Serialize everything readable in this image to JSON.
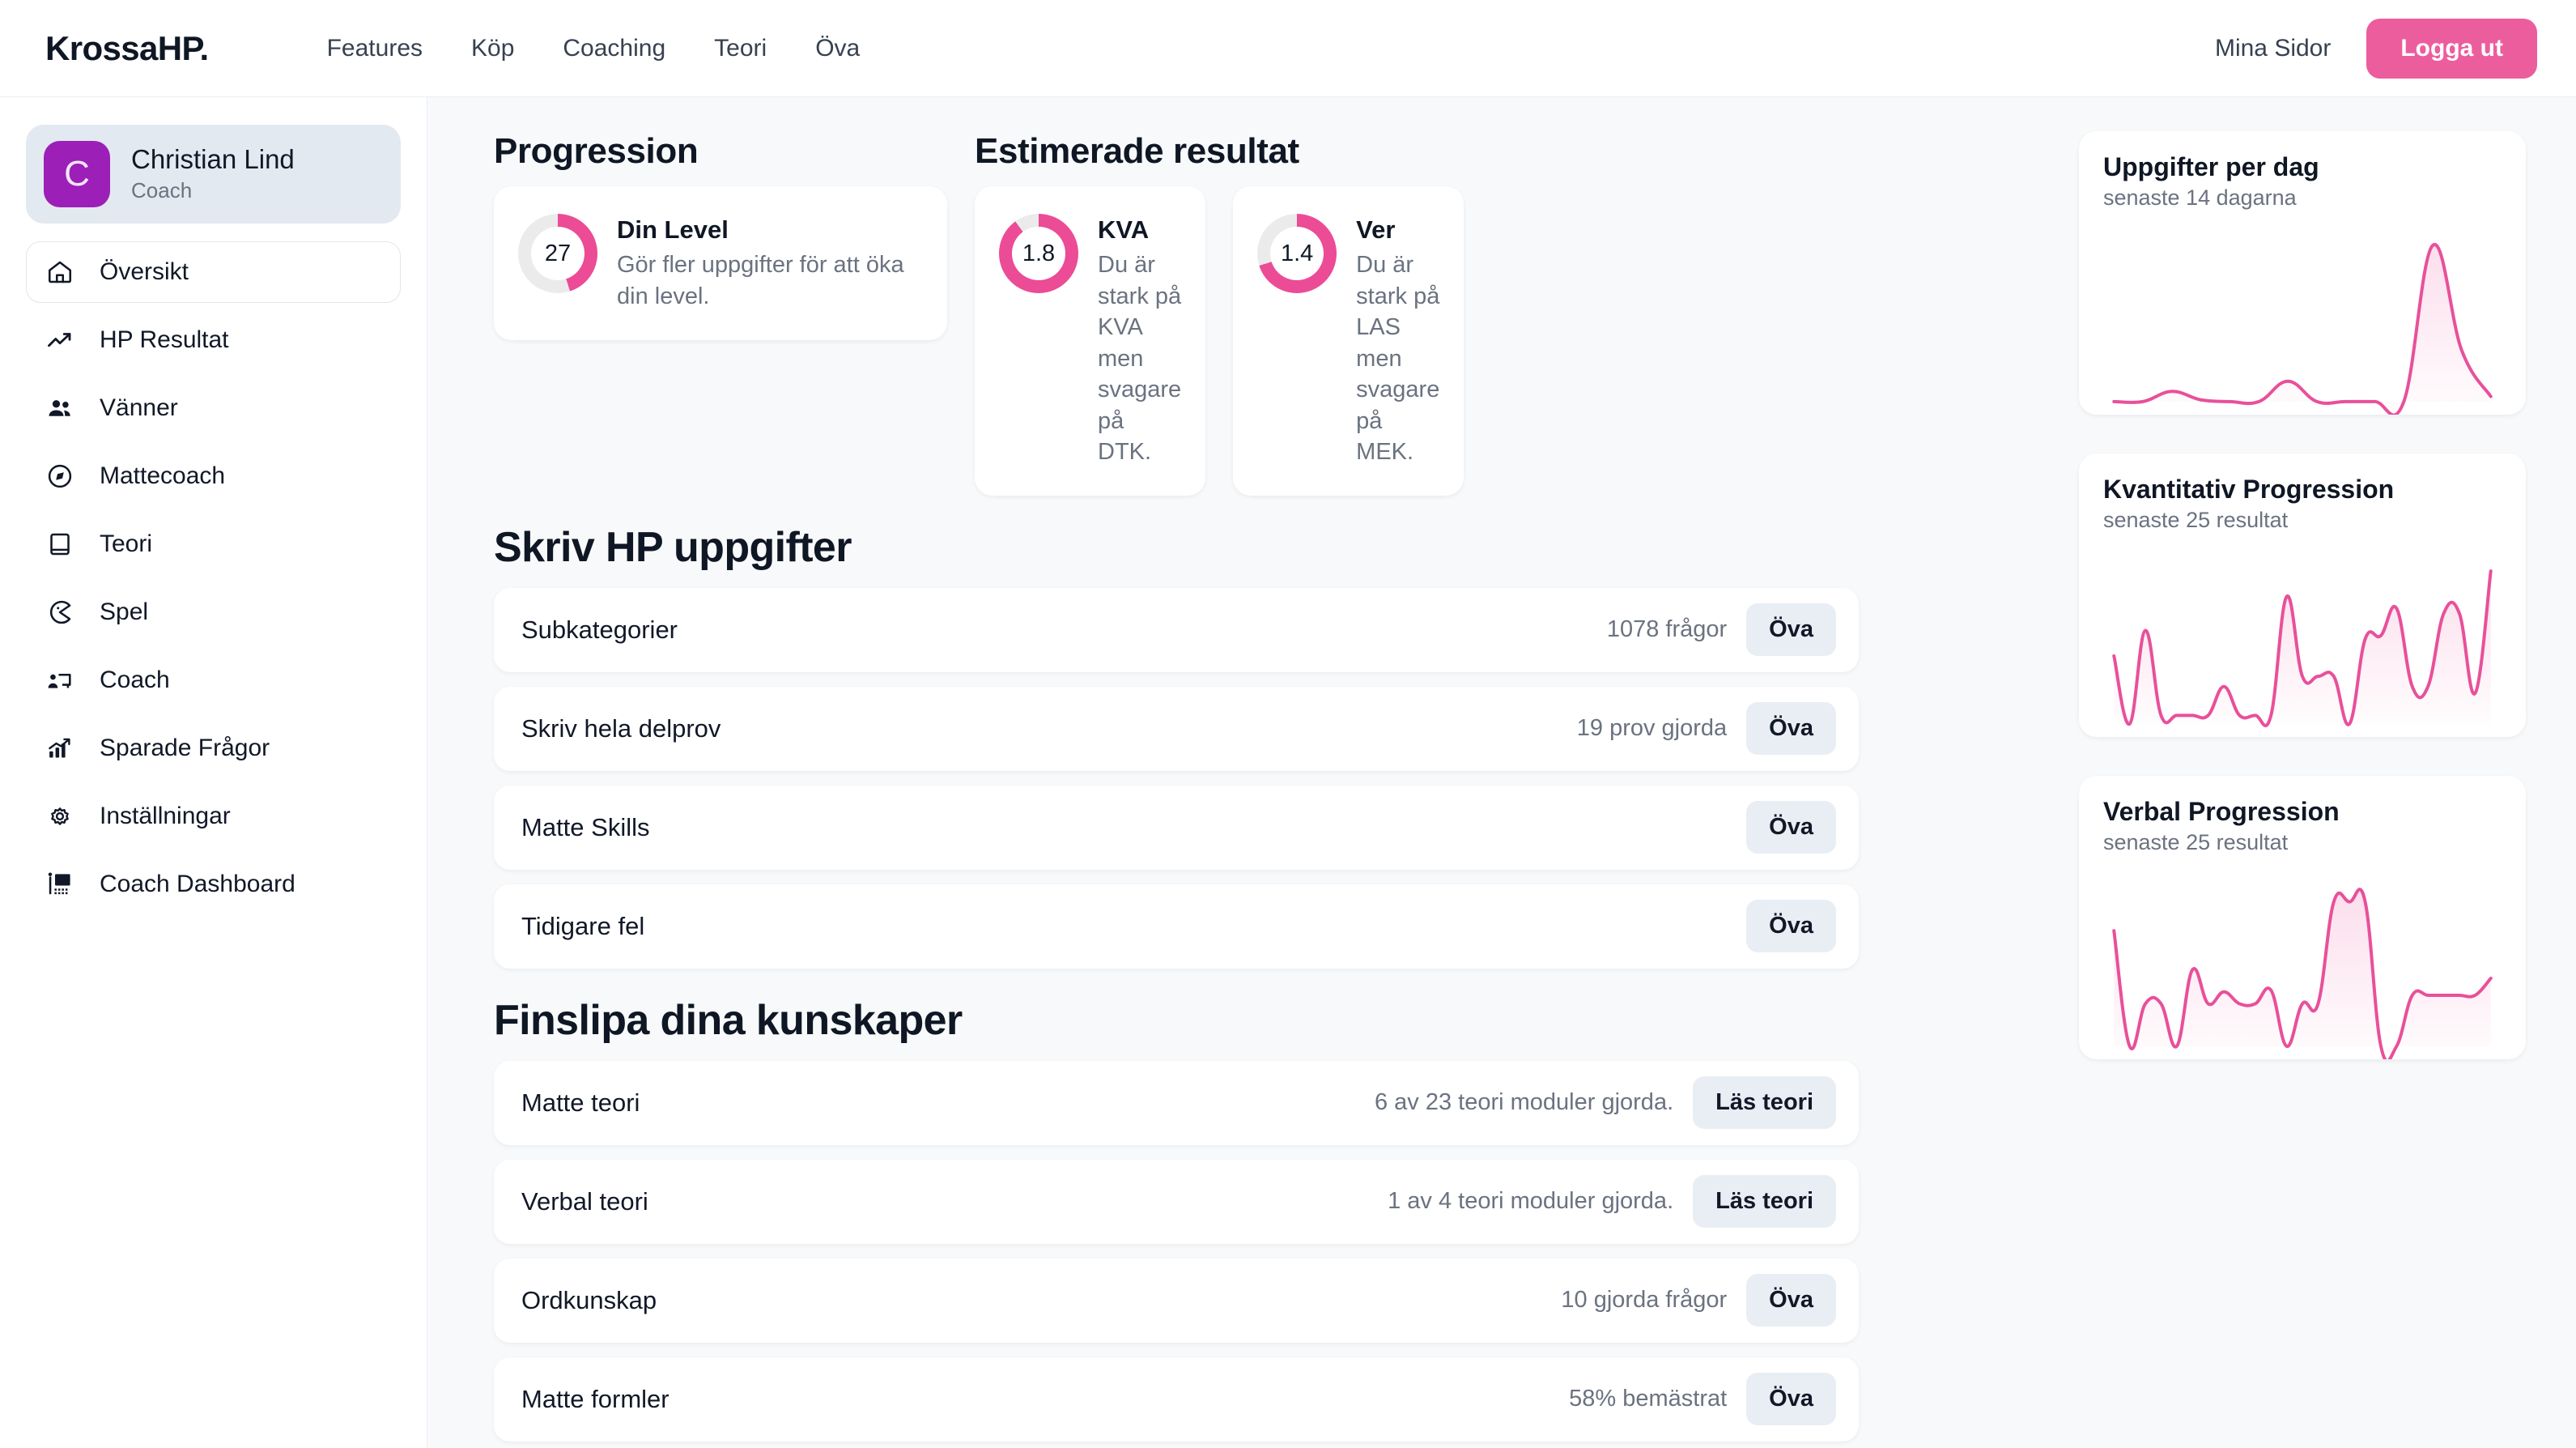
{
  "header": {
    "brand": "KrossaHP.",
    "nav": [
      {
        "label": "Features"
      },
      {
        "label": "Köp"
      },
      {
        "label": "Coaching"
      },
      {
        "label": "Teori"
      },
      {
        "label": "Öva"
      }
    ],
    "account_link": "Mina Sidor",
    "logout_label": "Logga ut",
    "accent_color": "#EC5D9E"
  },
  "sidebar": {
    "profile": {
      "initial": "C",
      "name": "Christian Lind",
      "role": "Coach",
      "avatar_color": "#9C1FB8",
      "card_color": "#E3E9F0"
    },
    "items": [
      {
        "label": "Översikt",
        "icon": "home-icon",
        "active": true
      },
      {
        "label": "HP Resultat",
        "icon": "trending-up-icon",
        "active": false
      },
      {
        "label": "Vänner",
        "icon": "people-icon",
        "active": false
      },
      {
        "label": "Mattecoach",
        "icon": "compass-icon",
        "active": false
      },
      {
        "label": "Teori",
        "icon": "book-icon",
        "active": false
      },
      {
        "label": "Spel",
        "icon": "game-icon",
        "active": false
      },
      {
        "label": "Coach",
        "icon": "presentation-person-icon",
        "active": false
      },
      {
        "label": "Sparade Frågor",
        "icon": "bar-chart-icon",
        "active": false
      },
      {
        "label": "Inställningar",
        "icon": "gear-icon",
        "active": false
      },
      {
        "label": "Coach Dashboard",
        "icon": "classroom-icon",
        "active": false
      }
    ]
  },
  "progression": {
    "title": "Progression",
    "card": {
      "value": "27",
      "percent": 45,
      "name": "Din Level",
      "desc": "Gör fler uppgifter för att öka din level."
    }
  },
  "estimated": {
    "title": "Estimerade resultat",
    "cards": [
      {
        "value": "1.8",
        "percent": 90,
        "name": "KVA",
        "desc": "Du är stark på KVA men svagare på DTK."
      },
      {
        "value": "1.4",
        "percent": 70,
        "name": "Ver",
        "desc": "Du är stark på LAS men svagare på MEK."
      }
    ]
  },
  "tasks": {
    "title": "Skriv HP uppgifter",
    "rows": [
      {
        "label": "Subkategorier",
        "meta": "1078 frågor",
        "button": "Öva"
      },
      {
        "label": "Skriv hela delprov",
        "meta": "19 prov gjorda",
        "button": "Öva"
      },
      {
        "label": "Matte Skills",
        "meta": "",
        "button": "Öva"
      },
      {
        "label": "Tidigare fel",
        "meta": "",
        "button": "Öva"
      }
    ]
  },
  "refine": {
    "title": "Finslipa dina kunskaper",
    "rows": [
      {
        "label": "Matte teori",
        "meta": "6 av 23 teori moduler gjorda.",
        "button": "Läs teori"
      },
      {
        "label": "Verbal teori",
        "meta": "1 av 4 teori moduler gjorda.",
        "button": "Läs teori"
      },
      {
        "label": "Ordkunskap",
        "meta": "10 gjorda frågor",
        "button": "Öva"
      },
      {
        "label": "Matte formler",
        "meta": "58% bemästrat",
        "button": "Öva"
      }
    ]
  },
  "chart_data": [
    {
      "type": "area",
      "title": "Uppgifter per dag",
      "subtitle": "senaste 14 dagarna",
      "xlabel": "",
      "ylabel": "",
      "grid": false,
      "legend": false,
      "x": [
        1,
        2,
        3,
        4,
        5,
        6,
        7,
        8,
        9,
        10,
        11,
        12,
        13,
        14
      ],
      "values": [
        0,
        0,
        6,
        1,
        0,
        0,
        12,
        0,
        0,
        0,
        0,
        92,
        30,
        3
      ],
      "ylim": [
        0,
        100
      ],
      "line_color": "#E8509A",
      "fill_color": "#FBDCEB"
    },
    {
      "type": "area",
      "title": "Kvantitativ Progression",
      "subtitle": "senaste 25 resultat",
      "xlabel": "",
      "ylabel": "",
      "grid": false,
      "legend": false,
      "x": [
        1,
        2,
        3,
        4,
        5,
        6,
        7,
        8,
        9,
        10,
        11,
        12,
        13,
        14,
        15,
        16,
        17,
        18,
        19,
        20,
        21,
        22,
        23,
        24,
        25
      ],
      "values": [
        40,
        0,
        55,
        5,
        5,
        5,
        5,
        22,
        5,
        5,
        5,
        75,
        28,
        28,
        28,
        0,
        50,
        52,
        68,
        22,
        22,
        65,
        65,
        18,
        90
      ],
      "ylim": [
        0,
        100
      ],
      "line_color": "#E8509A",
      "fill_color": "#FBDCEB"
    },
    {
      "type": "area",
      "title": "Verbal Progression",
      "subtitle": "senaste 25 resultat",
      "xlabel": "",
      "ylabel": "",
      "grid": false,
      "legend": false,
      "x": [
        1,
        2,
        3,
        4,
        5,
        6,
        7,
        8,
        9,
        10,
        11,
        12,
        13,
        14,
        15,
        16,
        17,
        18,
        19,
        20,
        21,
        22,
        23,
        24,
        25
      ],
      "values": [
        68,
        0,
        25,
        25,
        0,
        45,
        25,
        32,
        25,
        25,
        33,
        0,
        25,
        25,
        85,
        85,
        85,
        0,
        0,
        30,
        30,
        30,
        30,
        30,
        40
      ],
      "ylim": [
        0,
        100
      ],
      "line_color": "#E8509A",
      "fill_color": "#FBDCEB"
    }
  ]
}
